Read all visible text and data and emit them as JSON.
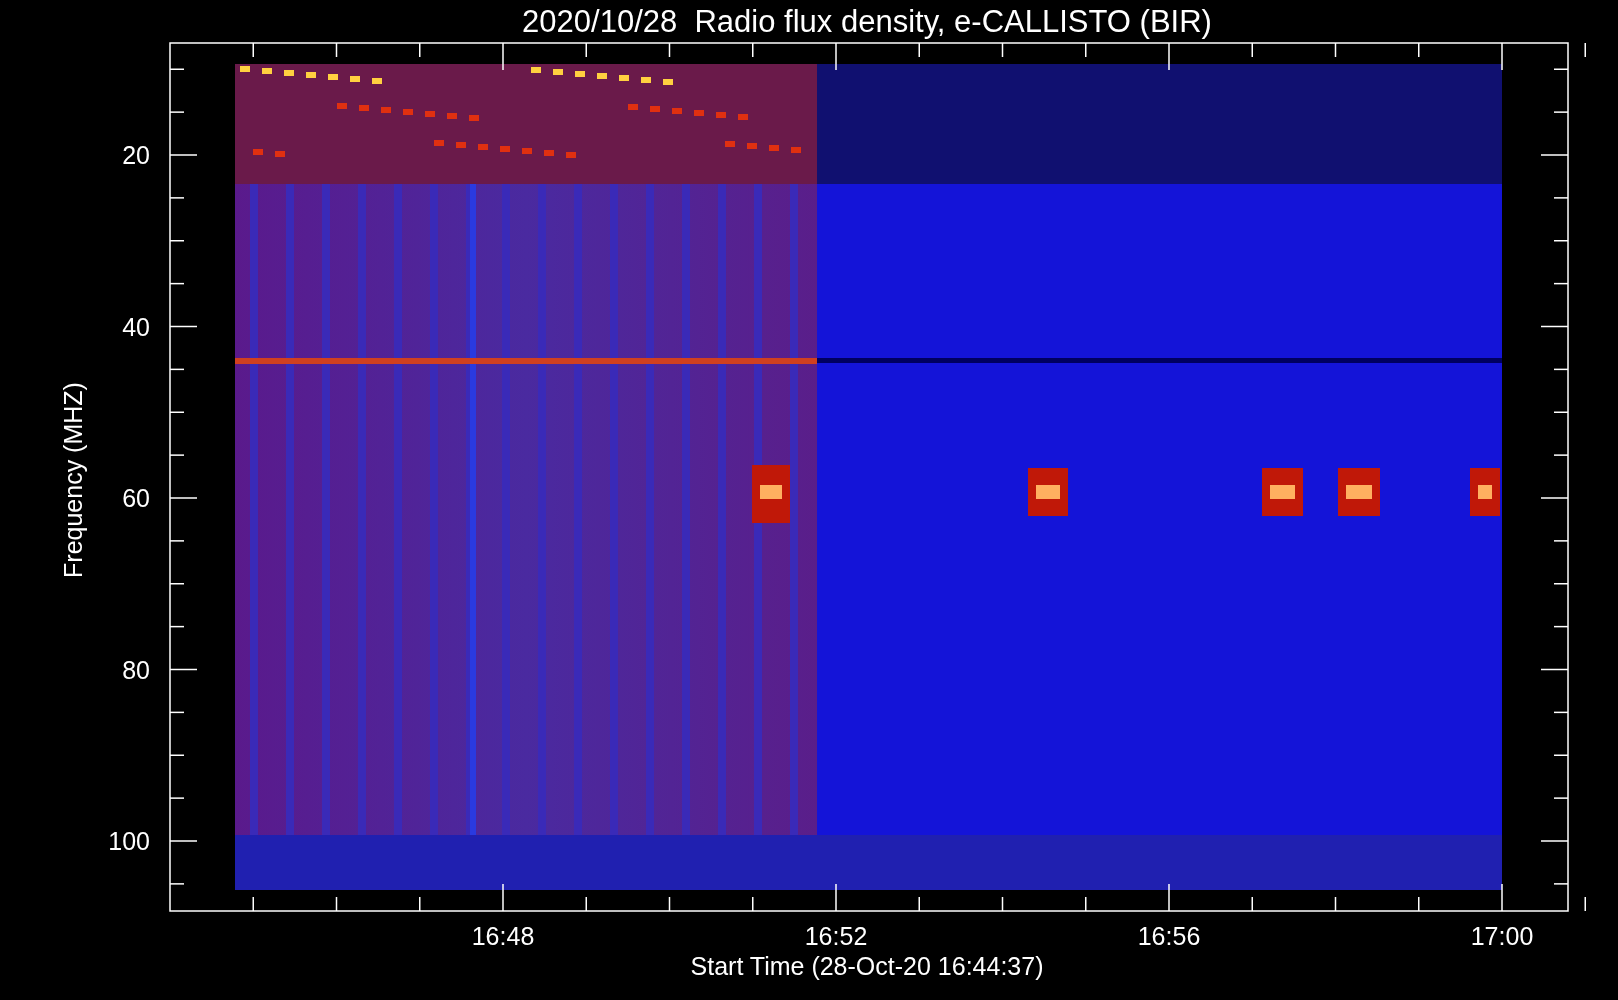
{
  "title": "2020/10/28  Radio flux density, e-CALLISTO (BIR)",
  "y_axis": {
    "label": "Frequency (MHZ)",
    "ticks": [
      "20",
      "40",
      "60",
      "80",
      "100"
    ]
  },
  "x_axis": {
    "label": "Start Time (28-Oct-20 16:44:37)",
    "ticks": [
      "16:48",
      "16:52",
      "16:56",
      "17:00"
    ]
  }
}
